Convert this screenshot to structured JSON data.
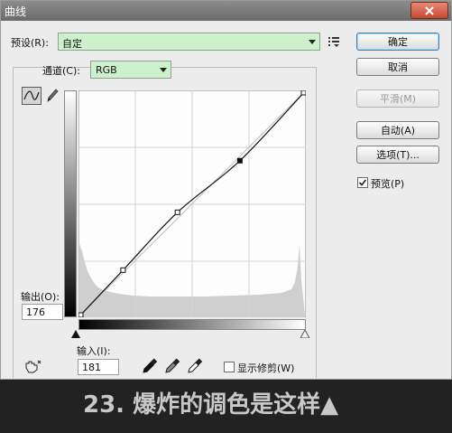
{
  "dialog": {
    "title": "曲线",
    "close_icon": "close-icon"
  },
  "preset": {
    "label": "预设(R):",
    "value": "自定",
    "menu_icon": "preset-options-icon"
  },
  "buttons": {
    "ok": "确定",
    "cancel": "取消",
    "smooth": "平滑(M)",
    "auto": "自动(A)",
    "options": "选项(T)..."
  },
  "preview": {
    "label": "预览(P)",
    "checked": true
  },
  "channel": {
    "label": "通道(C):",
    "value": "RGB"
  },
  "tools": {
    "curve_tool": "curve-point-icon",
    "pencil_tool": "pencil-icon",
    "target_adjust": "hand-adjust-icon",
    "eyedroppers": [
      "black-eyedropper-icon",
      "gray-eyedropper-icon",
      "white-eyedropper-icon"
    ]
  },
  "output": {
    "label": "输出(O):",
    "value": "176"
  },
  "input": {
    "label": "输入(I):",
    "value": "181"
  },
  "show_clipping": {
    "label": "显示修剪(W)",
    "checked": false
  },
  "curve": {
    "range": [
      0,
      255
    ],
    "points": [
      [
        0,
        0
      ],
      [
        50,
        53
      ],
      [
        111,
        118
      ],
      [
        181,
        176
      ],
      [
        255,
        255
      ]
    ],
    "selected_point_index": 3
  },
  "caption": "23. 爆炸的调色是这样▲"
}
